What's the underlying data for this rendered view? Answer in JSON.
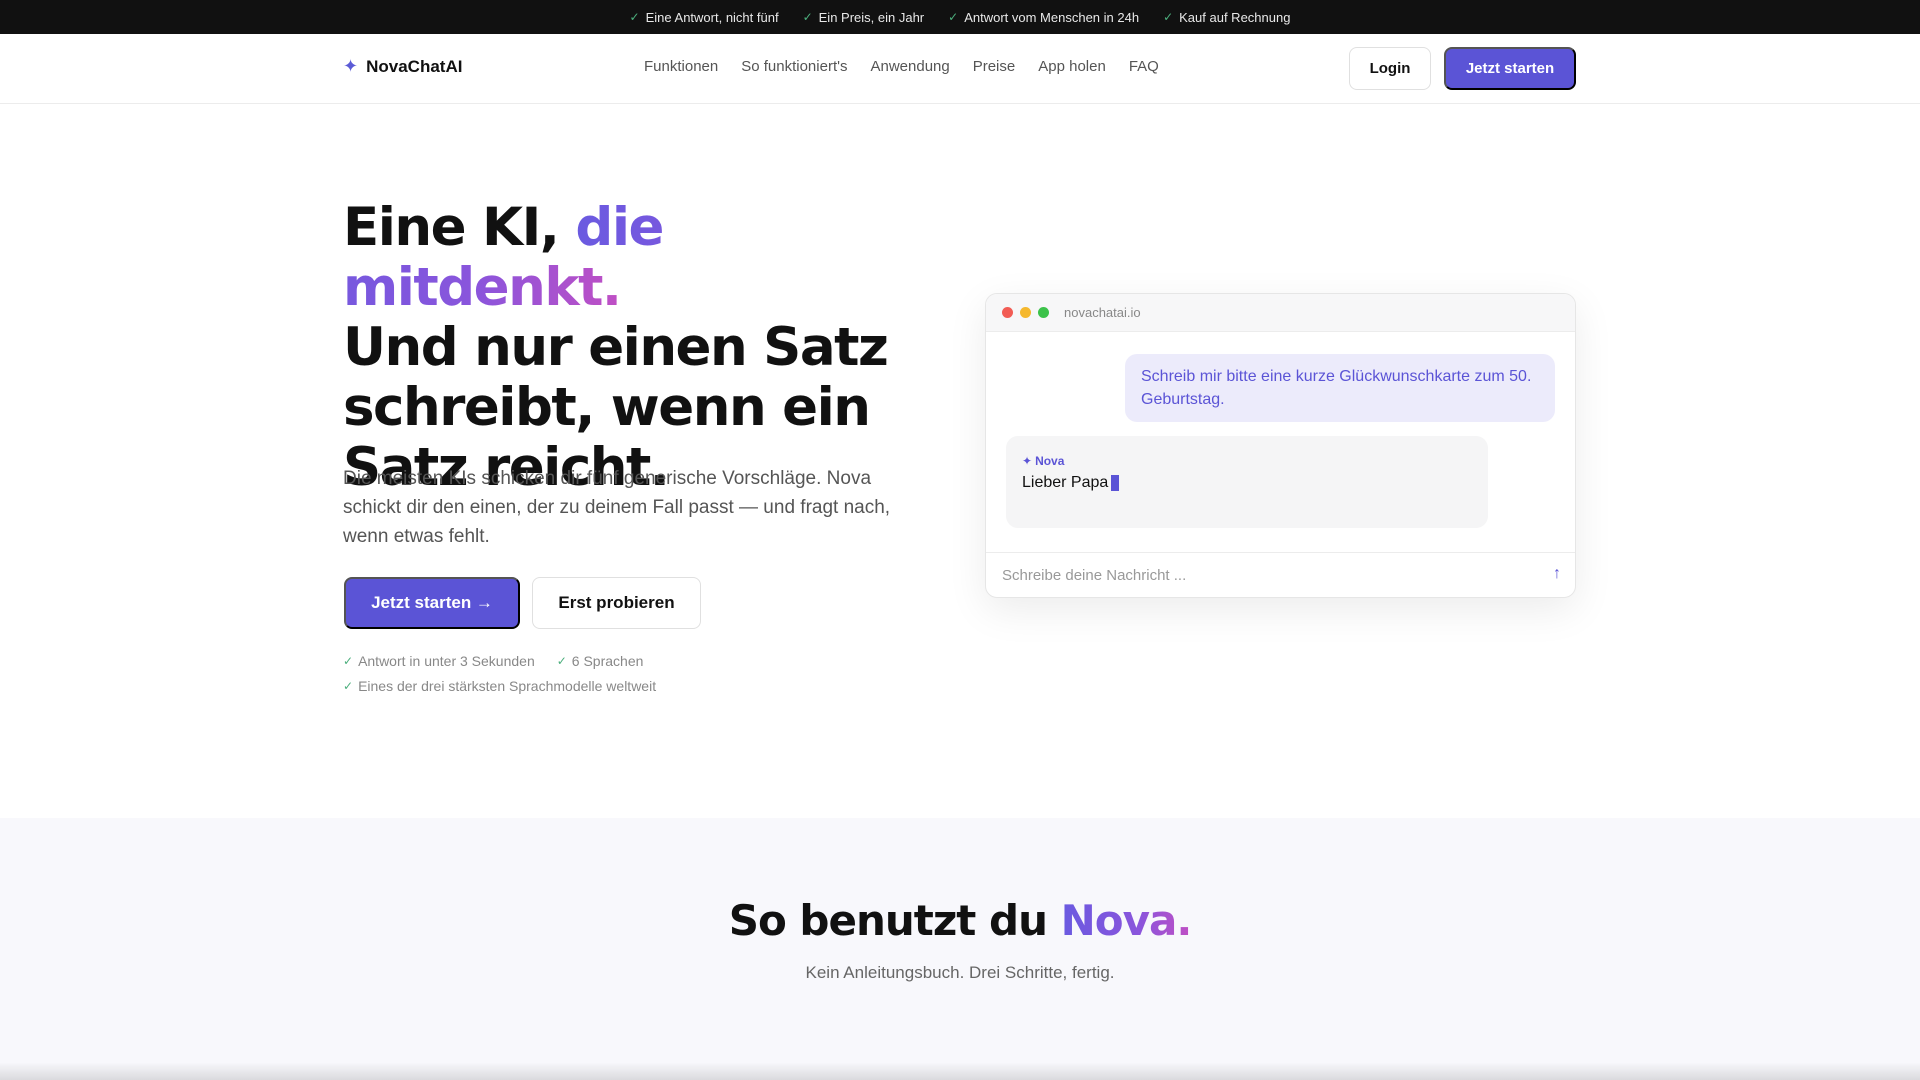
{
  "topbar": {
    "items": [
      "Eine Antwort, nicht fünf",
      "Ein Preis, ein Jahr",
      "Antwort vom Menschen in 24h",
      "Kauf auf Rechnung"
    ]
  },
  "nav": {
    "logo": "NovaChatAI",
    "links": [
      "Funktionen",
      "So funktioniert's",
      "Anwendung",
      "Preise",
      "App holen",
      "FAQ"
    ],
    "login": "Login",
    "start": "Jetzt starten"
  },
  "hero": {
    "title_part1": "Eine KI, ",
    "title_highlight": "die mitdenkt.",
    "title_part2": "Und nur einen Satz schreibt, wenn ein Satz reicht.",
    "subtitle": "Die meisten KIs schicken dir fünf generische Vorschläge. Nova schickt dir den einen, der zu deinem Fall passt — und fragt nach, wenn etwas fehlt.",
    "cta_primary": "Jetzt starten →",
    "cta_secondary": "Erst probieren",
    "bullets": [
      "Antwort in unter 3 Sekunden",
      "6 Sprachen",
      "Eines der drei stärksten Sprachmodelle weltweit"
    ]
  },
  "chat": {
    "url": "novachatai.io",
    "user_message": "Schreib mir bitte eine kurze Glückwunschkarte zum 50. Geburtstag.",
    "nova_label": "Nova",
    "nova_text": "Lieber Papa",
    "input_placeholder": "Schreibe deine Nachricht ..."
  },
  "section2": {
    "title_part1": "So benutzt du ",
    "title_highlight": "Nova.",
    "subtitle": "Kein Anleitungsbuch. Drei Schritte, fertig."
  },
  "colors": {
    "accent": "#5b54d6",
    "topbar_bg": "#111111",
    "check": "#4caf7d"
  }
}
